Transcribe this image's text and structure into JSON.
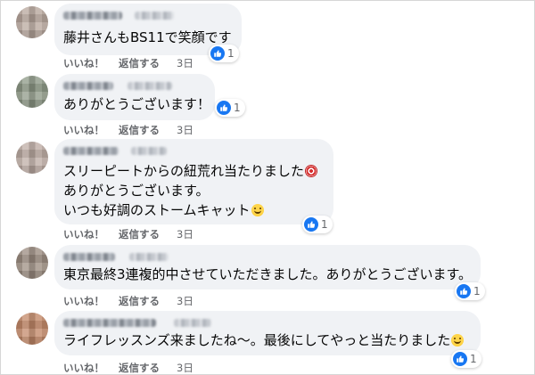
{
  "comments": [
    {
      "lines": [
        "藤井さんもBS11で笑顔です"
      ],
      "reaction_icon": "like-icon",
      "reaction_count": "1",
      "actions": {
        "like": "いいね！",
        "reply": "返信する",
        "time": "3日"
      }
    },
    {
      "lines": [
        "ありがとうございます！"
      ],
      "reaction_icon": "like-icon",
      "reaction_count": "1",
      "actions": {
        "like": "いいね！",
        "reply": "返信する",
        "time": "3日"
      }
    },
    {
      "lines": [
        "スリーピートからの紐荒れ当たりました",
        "ありがとうございます。",
        "いつも好調のストームキャット"
      ],
      "emojis": [
        "dart-emoji",
        "smile-emoji"
      ],
      "reaction_icon": "like-icon",
      "reaction_count": "1",
      "actions": {
        "like": "いいね！",
        "reply": "返信する",
        "time": "3日"
      }
    },
    {
      "lines": [
        "東京最終3連複的中させていただきました。ありがとうございます。"
      ],
      "reaction_icon": "like-icon",
      "reaction_count": "1",
      "actions": {
        "like": "いいね！",
        "reply": "返信する",
        "time": "3日"
      }
    },
    {
      "lines": [
        "ライフレッスンズ来ましたね〜。最後にしてやっと当たりました"
      ],
      "emojis": [
        "smile-emoji"
      ],
      "reaction_icon": "like-icon",
      "reaction_count": "1",
      "actions": {
        "like": "いいね！",
        "reply": "返信する",
        "time": "3日"
      }
    }
  ],
  "colors": {
    "like_blue": "#1877f2",
    "bubble_bg": "#f0f2f5",
    "meta_gray": "#65676b"
  }
}
